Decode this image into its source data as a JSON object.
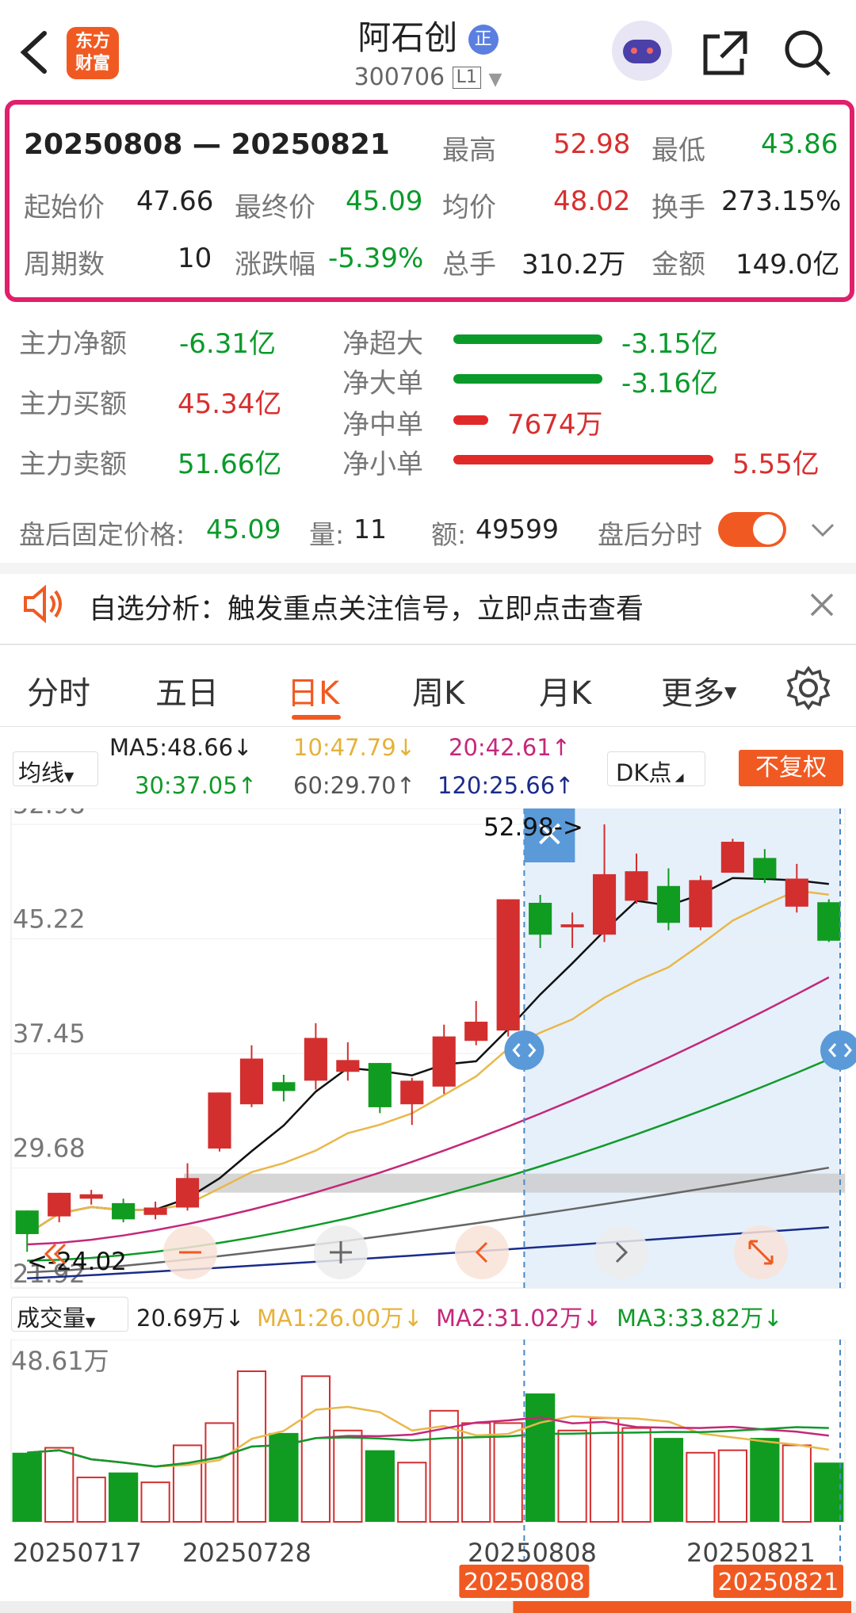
{
  "header": {
    "title": "阿石创",
    "title_badge": "正",
    "code": "300706",
    "level": "L1"
  },
  "logo": {
    "line1": "东方",
    "line2": "财富"
  },
  "summary": {
    "period": "20250808 — 20250821",
    "high_label": "最高",
    "high": "52.98",
    "low_label": "最低",
    "low": "43.86",
    "open_label": "起始价",
    "open": "47.66",
    "close_label": "最终价",
    "close": "45.09",
    "avg_label": "均价",
    "avg": "48.02",
    "turnover_label": "换手",
    "turnover": "273.15%",
    "count_label": "周期数",
    "count": "10",
    "change_label": "涨跌幅",
    "change": "-5.39%",
    "volume_label": "总手",
    "volume": "310.2万",
    "amount_label": "金额",
    "amount": "149.0亿"
  },
  "money_flow": {
    "net_label": "主力净额",
    "net": "-6.31亿",
    "buy_label": "主力买额",
    "buy": "45.34亿",
    "sell_label": "主力卖额",
    "sell": "51.66亿",
    "rows": [
      {
        "label": "净超大",
        "value": "-3.15亿",
        "ratio": -0.57
      },
      {
        "label": "净大单",
        "value": "-3.16亿",
        "ratio": -0.57
      },
      {
        "label": "净中单",
        "value": "7674万",
        "ratio": 0.14
      },
      {
        "label": "净小单",
        "value": "5.55亿",
        "ratio": 1.0
      }
    ]
  },
  "after_hours": {
    "label": "盘后固定价格:",
    "price": "45.09",
    "qty_label": "量:",
    "qty": "11",
    "amt_label": "额:",
    "amt": "49599",
    "toggle_label": "盘后分时"
  },
  "notice": {
    "text": "自选分析：触发重点关注信号，立即点击查看"
  },
  "tabs": [
    "分时",
    "五日",
    "日K",
    "周K",
    "月K",
    "更多"
  ],
  "active_tab": "日K",
  "ma": {
    "select": "均线",
    "ma5": "MA5:48.66↓",
    "ma10": "10:47.79↓",
    "ma20": "20:42.61↑",
    "ma30": "30:37.05↑",
    "ma60": "60:29.70↑",
    "ma120": "120:25.66↑",
    "dk": "DK点",
    "fq": "不复权"
  },
  "chart_data": {
    "type": "candlestick",
    "y_ticks": [
      "52.98",
      "45.22",
      "37.45",
      "29.68",
      "21.92"
    ],
    "ylim": [
      21.92,
      52.98
    ],
    "high_marker": "52.98->",
    "low_marker": "<-24.02",
    "candles": [
      {
        "o": 26.8,
        "c": 25.2,
        "h": 26.8,
        "l": 24.0
      },
      {
        "o": 26.4,
        "c": 28.0,
        "h": 28.0,
        "l": 26.0
      },
      {
        "o": 27.6,
        "c": 27.9,
        "h": 28.2,
        "l": 27.2
      },
      {
        "o": 27.3,
        "c": 26.2,
        "h": 27.6,
        "l": 26.0
      },
      {
        "o": 26.5,
        "c": 27.0,
        "h": 27.4,
        "l": 26.2
      },
      {
        "o": 27.0,
        "c": 29.0,
        "h": 30.0,
        "l": 26.8
      },
      {
        "o": 31.0,
        "c": 34.8,
        "h": 34.8,
        "l": 30.8
      },
      {
        "o": 34.0,
        "c": 37.1,
        "h": 38.0,
        "l": 33.8
      },
      {
        "o": 35.5,
        "c": 34.9,
        "h": 36.0,
        "l": 34.2
      },
      {
        "o": 35.6,
        "c": 38.5,
        "h": 39.5,
        "l": 35.0
      },
      {
        "o": 36.2,
        "c": 37.0,
        "h": 38.2,
        "l": 35.6
      },
      {
        "o": 36.8,
        "c": 33.8,
        "h": 36.8,
        "l": 33.4
      },
      {
        "o": 34.0,
        "c": 35.6,
        "h": 35.8,
        "l": 32.6
      },
      {
        "o": 35.2,
        "c": 38.6,
        "h": 39.4,
        "l": 34.7
      },
      {
        "o": 38.3,
        "c": 39.6,
        "h": 41.0,
        "l": 38.0
      },
      {
        "o": 39.0,
        "c": 47.9,
        "h": 47.9,
        "l": 38.6
      },
      {
        "o": 47.66,
        "c": 45.5,
        "h": 48.2,
        "l": 44.6
      },
      {
        "o": 46.0,
        "c": 46.2,
        "h": 47.0,
        "l": 44.6
      },
      {
        "o": 45.5,
        "c": 49.6,
        "h": 52.98,
        "l": 45.0
      },
      {
        "o": 47.8,
        "c": 49.8,
        "h": 51.0,
        "l": 47.6
      },
      {
        "o": 48.8,
        "c": 46.3,
        "h": 50.0,
        "l": 45.8
      },
      {
        "o": 46.0,
        "c": 49.2,
        "h": 49.5,
        "l": 45.8
      },
      {
        "o": 49.7,
        "c": 51.8,
        "h": 52.0,
        "l": 49.7
      },
      {
        "o": 50.7,
        "c": 49.3,
        "h": 51.3,
        "l": 49.0
      },
      {
        "o": 47.4,
        "c": 49.3,
        "h": 50.3,
        "l": 47.0
      },
      {
        "o": 47.7,
        "c": 45.09,
        "h": 47.9,
        "l": 45.0
      }
    ],
    "volume": {
      "label": "成交量",
      "current": "20.69万↓",
      "ma1": "MA1:26.00万↓",
      "ma2": "MA2:31.02万↓",
      "ma3": "MA3:33.82万↓",
      "y_max": "48.61万"
    },
    "volumes": [
      28,
      30,
      18,
      20,
      16,
      31,
      40,
      61,
      36,
      59,
      37,
      29,
      24,
      45,
      40,
      40,
      52,
      37,
      42,
      38,
      34,
      28,
      29,
      34,
      31,
      24
    ],
    "dates": [
      "20250717",
      "20250728",
      "20250808",
      "20250821"
    ],
    "range_start": "20250808",
    "range_end": "20250821"
  },
  "colors": {
    "up": "#d32f2f",
    "down": "#109c20",
    "accent": "#f05a22",
    "box": "#e0206a"
  }
}
